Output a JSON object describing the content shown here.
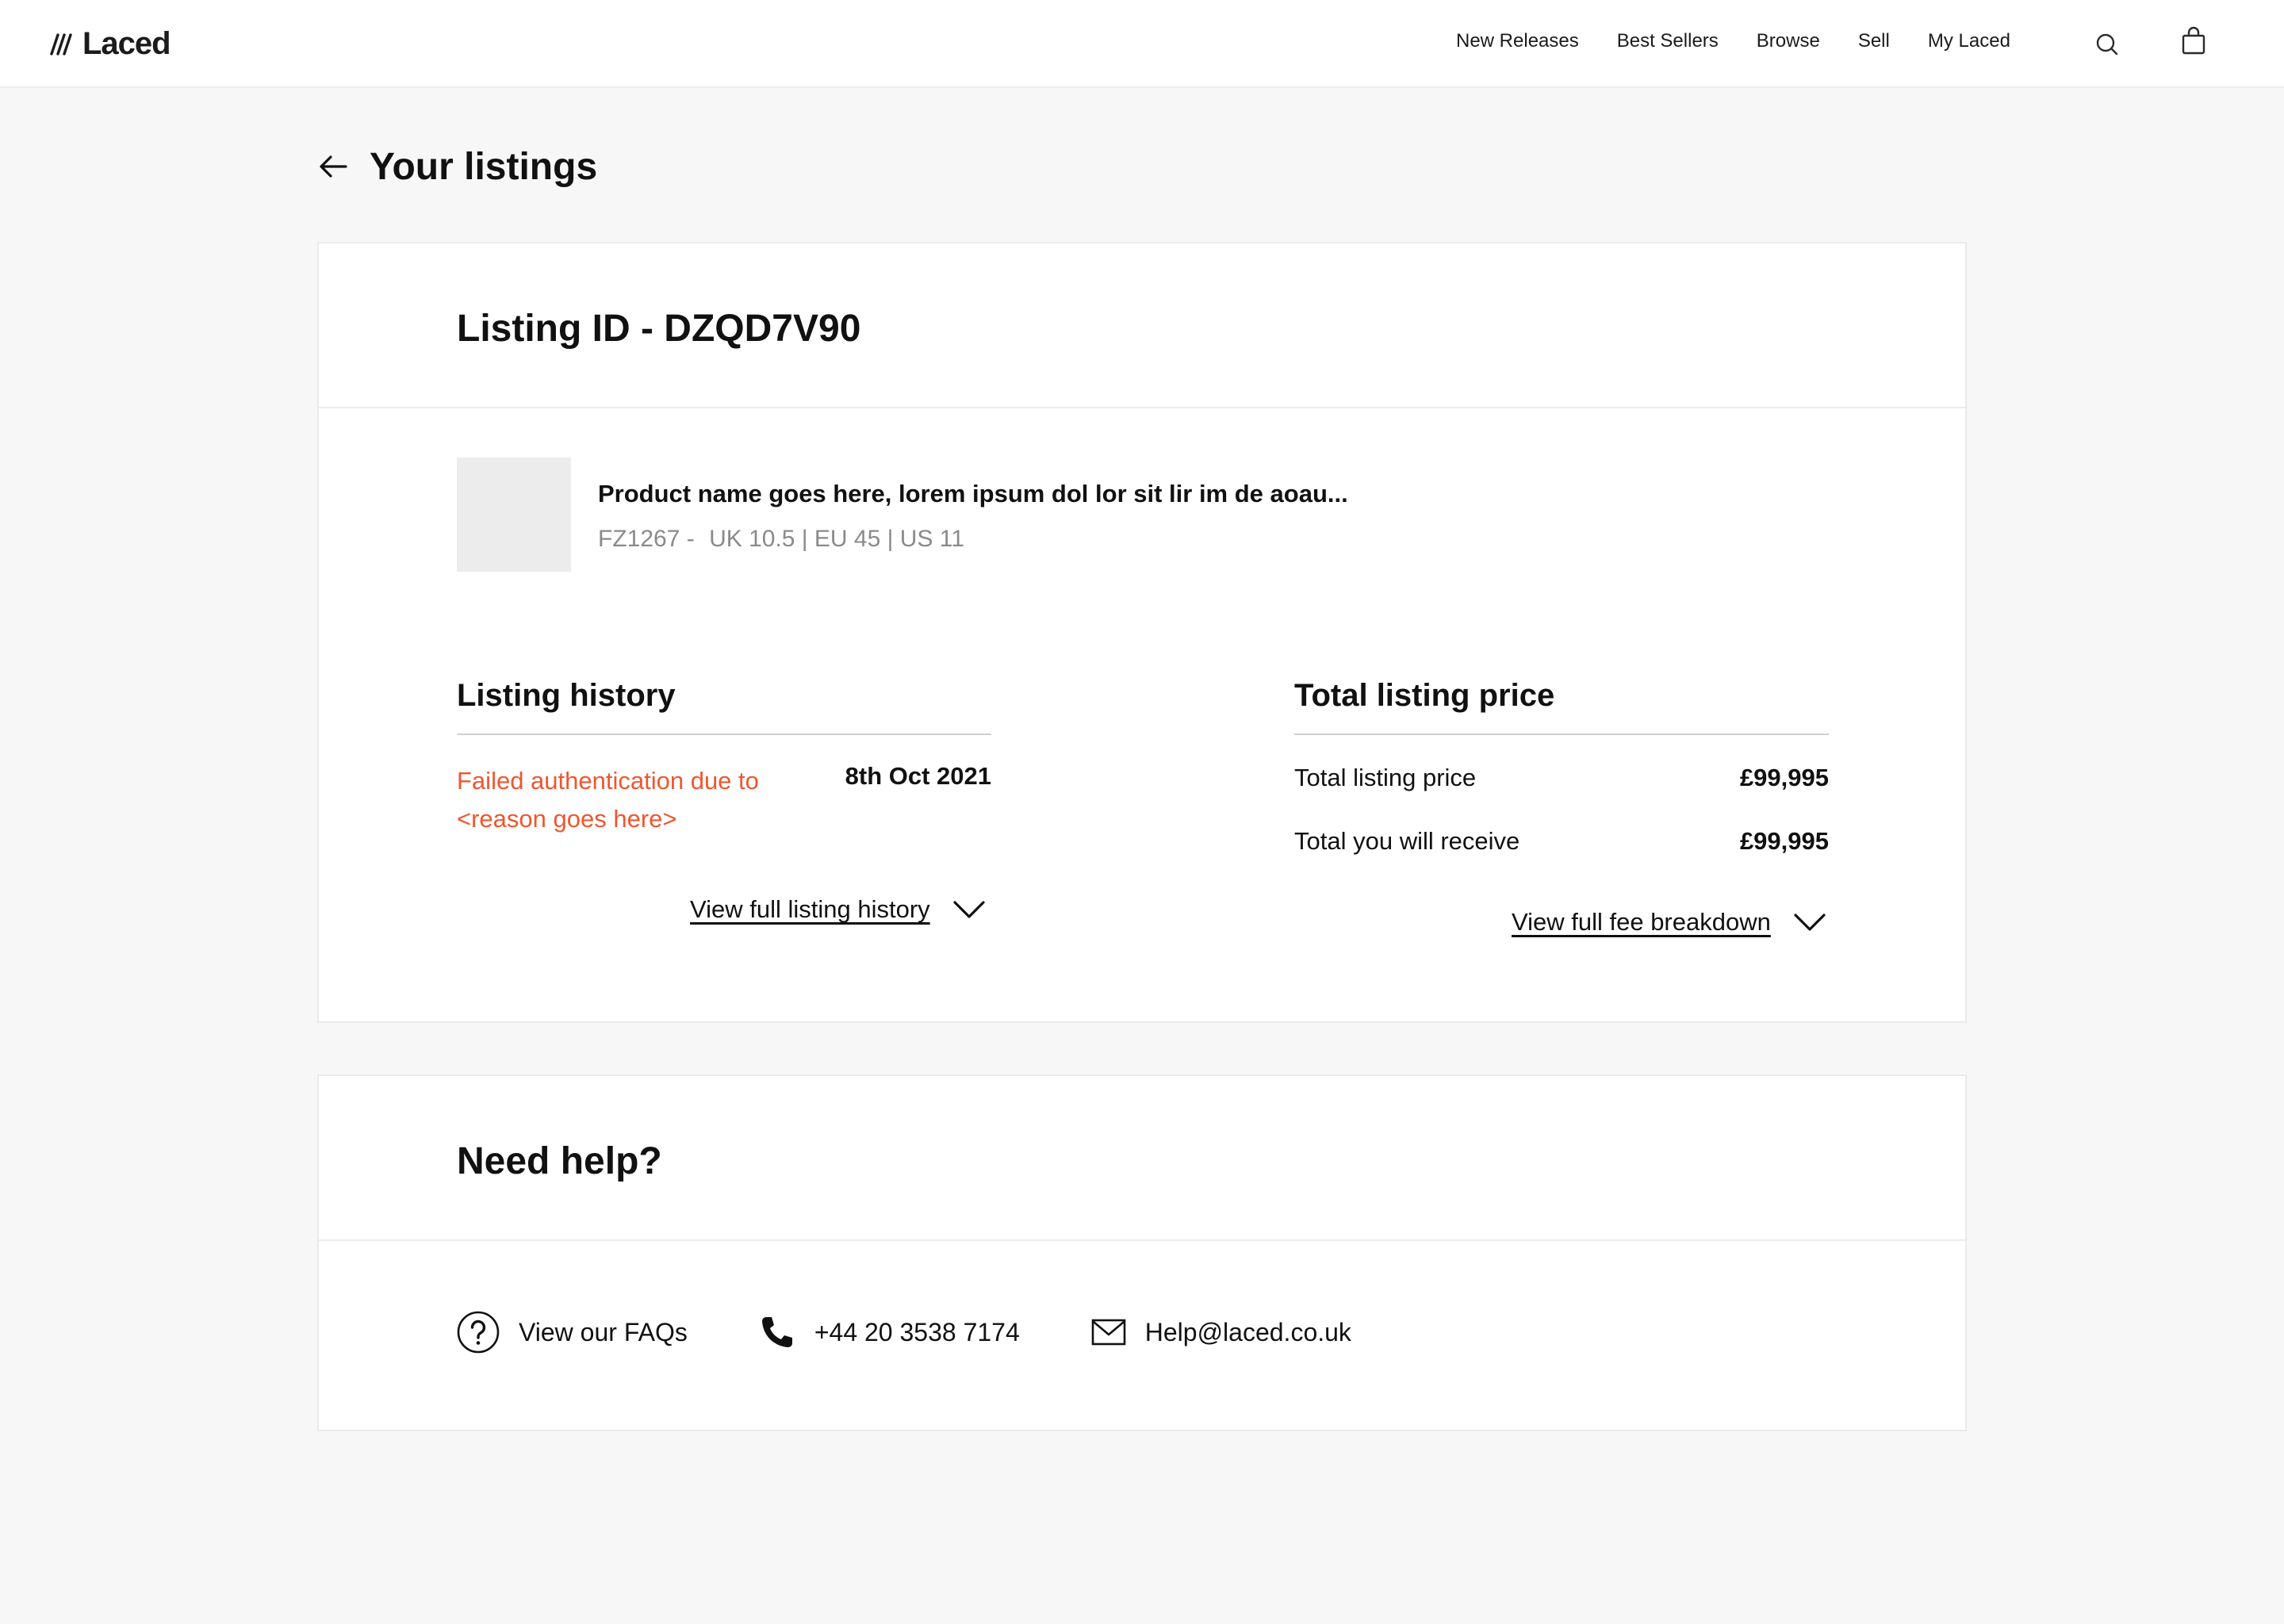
{
  "header": {
    "logo_text": "Laced",
    "nav": [
      "New Releases",
      "Best Sellers",
      "Browse",
      "Sell",
      "My Laced"
    ],
    "icons": [
      "search-icon",
      "bag-icon"
    ]
  },
  "page": {
    "title": "Your listings"
  },
  "listing": {
    "id_title": "Listing ID - DZQD7V90",
    "product": {
      "name": "Product name goes here, lorem ipsum dol lor sit lir im de aoau...",
      "sku": "FZ1267 -",
      "sizes": "UK 10.5 | EU 45 | US 11"
    },
    "history": {
      "title": "Listing history",
      "status": "Failed authentication due to <reason goes here>",
      "date": "8th Oct 2021",
      "view_link": "View full listing history"
    },
    "price": {
      "title": "Total listing price",
      "rows": [
        {
          "label": "Total listing price",
          "amount": "£99,995"
        },
        {
          "label": "Total you will receive",
          "amount": "£99,995"
        }
      ],
      "view_link": "View full fee breakdown"
    },
    "colors": {
      "error": "#f0562e"
    }
  },
  "help": {
    "title": "Need help?",
    "faq": "View our FAQs",
    "phone": "+44 20 3538 7174",
    "email": "Help@laced.co.uk"
  }
}
